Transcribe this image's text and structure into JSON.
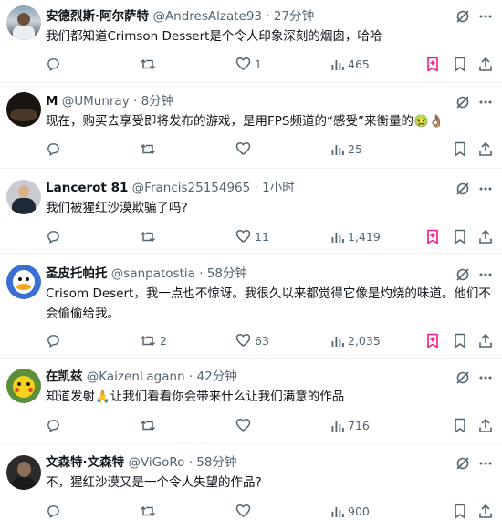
{
  "accent": "#f91880",
  "muted_color": "#536471",
  "tweets": [
    {
      "name": "安德烈斯·阿尔萨特",
      "handle": "@AndresAlzate93",
      "sep": "·",
      "time": "27分钟",
      "text": "我们都知道Crimson Dessert是个令人印象深刻的烟囱，哈哈",
      "replies": "",
      "retweets": "",
      "likes": "1",
      "views": "465"
    },
    {
      "name": "M",
      "handle": "@UMunray",
      "sep": "·",
      "time": "8分钟",
      "text": "现在，购买去享受即将发布的游戏，是用FPS频道的“感受”来衡量的🤢👌🏽",
      "replies": "",
      "retweets": "",
      "likes": "",
      "views": "25"
    },
    {
      "name": "Lancerot 81",
      "handle": "@Francis25154965",
      "sep": "·",
      "time": "1小时",
      "text": "我们被猩红沙漠欺骗了吗?",
      "replies": "",
      "retweets": "",
      "likes": "11",
      "views": "1,419"
    },
    {
      "name": "圣皮托帕托",
      "handle": "@sanpatostia",
      "sep": "·",
      "time": "58分钟",
      "text": "Crisom Desert，我一点也不惊讶。我很久以来都觉得它像是灼烧的味道。他们不会偷偷给我。",
      "replies": "",
      "retweets": "2",
      "likes": "63",
      "views": "2,035"
    },
    {
      "name": "在凯兹",
      "handle": "@KaizenLagann",
      "sep": "·",
      "time": "42分钟",
      "text": "知道发射🙏让我们看看你会带来什么让我们满意的作品",
      "replies": "",
      "retweets": "",
      "likes": "",
      "views": "716"
    },
    {
      "name": "文森特·文森特",
      "handle": "@ViGoRo",
      "sep": "·",
      "time": "58分钟",
      "text": "不，猩红沙漠又是一个令人失望的作品?",
      "replies": "",
      "retweets": "",
      "likes": "",
      "views": "900"
    }
  ]
}
